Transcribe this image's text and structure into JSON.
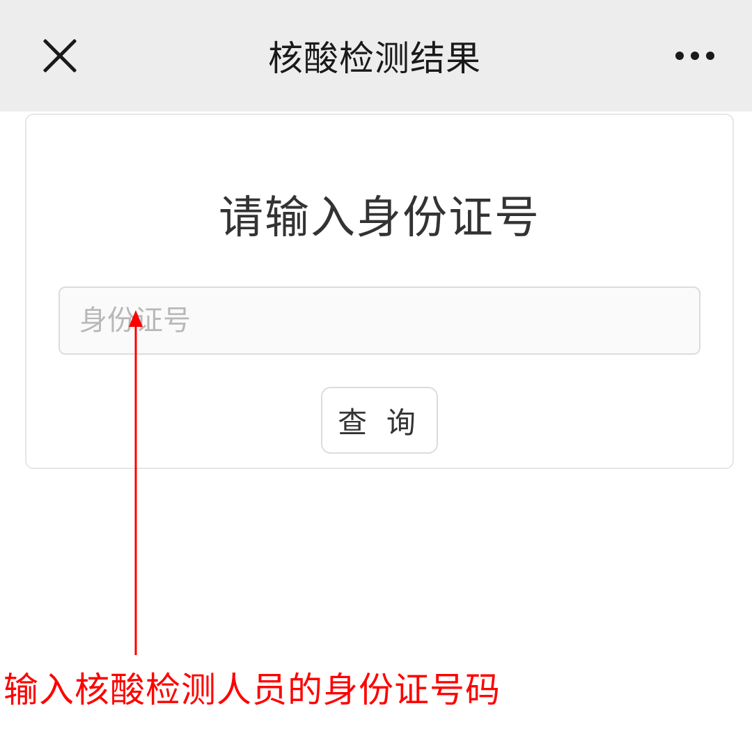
{
  "header": {
    "title": "核酸检测结果"
  },
  "card": {
    "heading": "请输入身份证号",
    "id_placeholder": "身份证号",
    "query_label": "查 询"
  },
  "annotation": {
    "text": "输入核酸检测人员的身份证号码"
  },
  "colors": {
    "header_bg": "#ededed",
    "border": "#e6e6e6",
    "annotation": "#ff0000"
  }
}
